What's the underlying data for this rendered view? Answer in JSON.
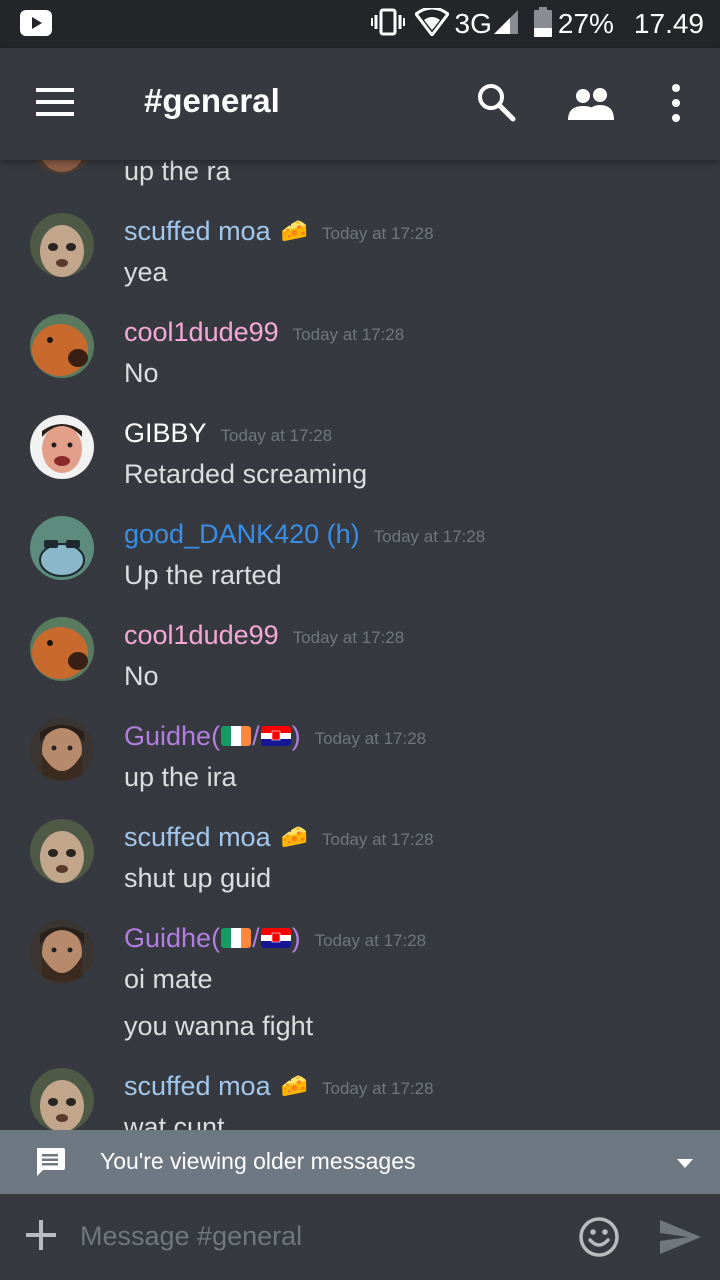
{
  "status_bar": {
    "network": "3G",
    "battery": "27%",
    "time": "17.49",
    "left_icon": "youtube-icon"
  },
  "header": {
    "channel": "#general",
    "icons": [
      "menu-icon",
      "search-icon",
      "members-icon",
      "more-vert-icon"
    ]
  },
  "top_partial_message": "up the ra",
  "messages": [
    {
      "author": "scuffed moa",
      "color": "#a3c7ea",
      "badge": "🧀",
      "timestamp": "Today at 17:28",
      "lines": [
        "yea"
      ]
    },
    {
      "author": "cool1dude99",
      "color": "#f5a9d4",
      "timestamp": "Today at 17:28",
      "lines": [
        "No"
      ]
    },
    {
      "author": "GIBBY",
      "color": "#ffffff",
      "timestamp": "Today at 17:28",
      "lines": [
        "Retarded screaming"
      ]
    },
    {
      "author": "good_DANK420 (h)",
      "color": "#3a8ee6",
      "timestamp": "Today at 17:28",
      "lines": [
        "Up the rarted"
      ]
    },
    {
      "author": "cool1dude99",
      "color": "#f5a9d4",
      "timestamp": "Today at 17:28",
      "lines": [
        "No"
      ]
    },
    {
      "author_prefix": "Guidhe(",
      "author_sep": "/",
      "author_suffix": ")",
      "color": "#b27ee0",
      "flags": [
        "ireland-flag",
        "croatia-flag"
      ],
      "timestamp": "Today at 17:28",
      "lines": [
        "up the ira"
      ]
    },
    {
      "author": "scuffed moa",
      "color": "#a3c7ea",
      "badge": "🧀",
      "timestamp": "Today at 17:28",
      "lines": [
        "shut up guid"
      ]
    },
    {
      "author_prefix": "Guidhe(",
      "author_sep": "/",
      "author_suffix": ")",
      "color": "#b27ee0",
      "flags": [
        "ireland-flag",
        "croatia-flag"
      ],
      "timestamp": "Today at 17:28",
      "lines": [
        "oi mate",
        "you wanna fight"
      ]
    },
    {
      "author": "scuffed moa",
      "color": "#a3c7ea",
      "badge": "🧀",
      "timestamp": "Today at 17:28",
      "lines": [
        "wat cunt"
      ]
    }
  ],
  "older_banner": {
    "text": "You're viewing older messages"
  },
  "composer": {
    "placeholder": "Message #general"
  }
}
